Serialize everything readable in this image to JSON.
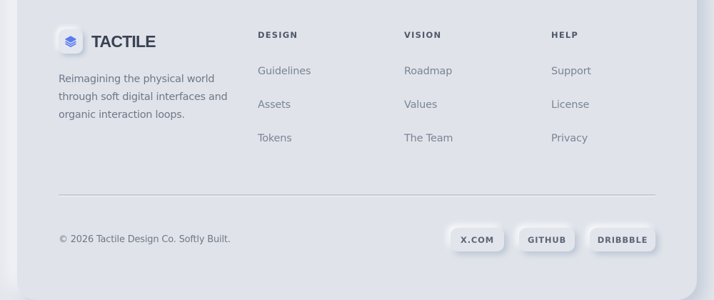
{
  "brand": {
    "name": "TACTILE",
    "accent_color": "#5b7cf0",
    "tagline": "Reimagining the physical world through soft digital interfaces and organic interaction loops."
  },
  "columns": [
    {
      "heading": "DESIGN",
      "links": [
        "Guidelines",
        "Assets",
        "Tokens"
      ]
    },
    {
      "heading": "VISION",
      "links": [
        "Roadmap",
        "Values",
        "The Team"
      ]
    },
    {
      "heading": "HELP",
      "links": [
        "Support",
        "License",
        "Privacy"
      ]
    }
  ],
  "footer": {
    "copyright": "© 2026 Tactile Design Co. Softly Built.",
    "social": [
      "X.COM",
      "GITHUB",
      "DRIBBBLE"
    ]
  }
}
